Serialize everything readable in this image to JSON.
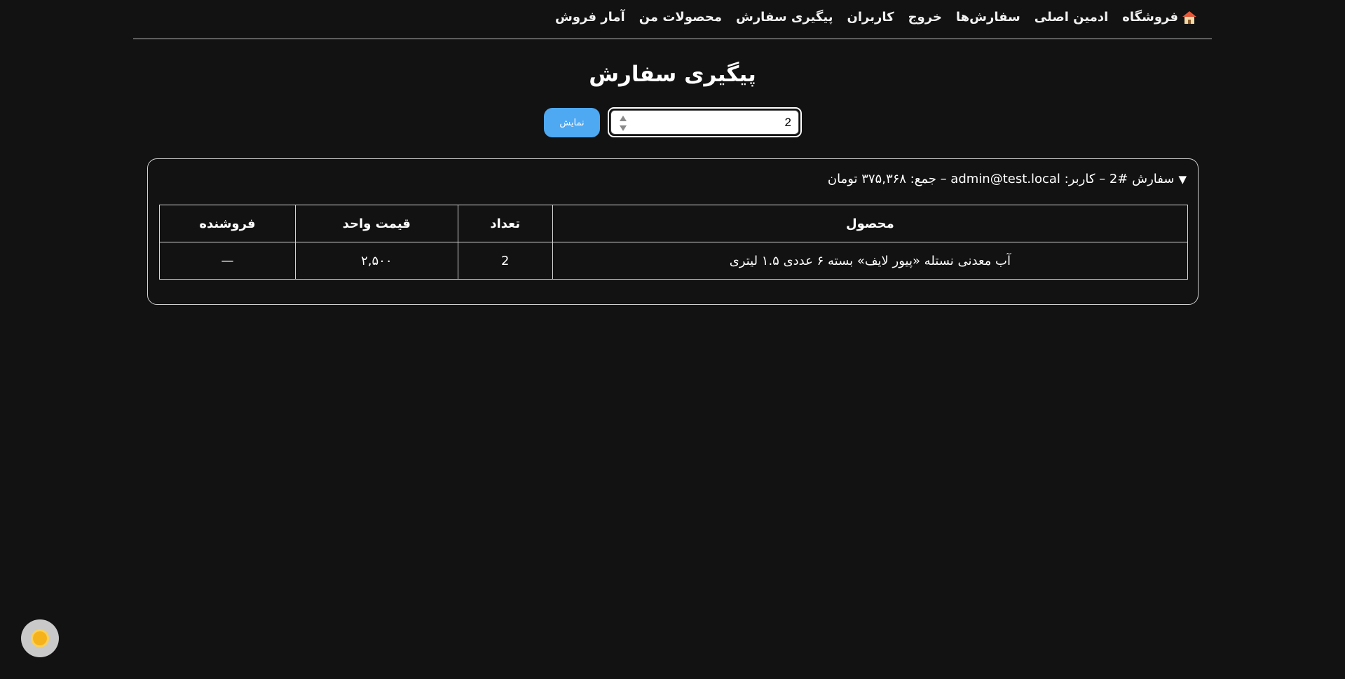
{
  "nav": {
    "items": [
      {
        "label": "فروشگاه",
        "icon": "home-icon"
      },
      {
        "label": "ادمین اصلی"
      },
      {
        "label": "سفارش‌ها"
      },
      {
        "label": "خروج"
      },
      {
        "label": "کاربران"
      },
      {
        "label": "پیگیری سفارش"
      },
      {
        "label": "محصولات من"
      },
      {
        "label": "آمار فروش"
      }
    ]
  },
  "page": {
    "title": "پیگیری سفارش"
  },
  "search": {
    "value": "2",
    "button_label": "نمایش"
  },
  "order": {
    "summary": "سفارش #2 – کاربر: admin@test.local – جمع: ۳۷۵,۳۶۸ تومان",
    "caret": "▼",
    "table": {
      "headers": [
        "محصول",
        "تعداد",
        "قیمت واحد",
        "فروشنده"
      ],
      "rows": [
        [
          "آب معدنی نستله «پیور لایف» بسته ۶ عددی ۱.۵ لیتری",
          "2",
          "۲,۵۰۰",
          "—"
        ]
      ]
    }
  },
  "theme_toggle": {
    "icon": "sun-icon"
  },
  "colors": {
    "background": "#121212",
    "accent": "#4ea8f2"
  }
}
